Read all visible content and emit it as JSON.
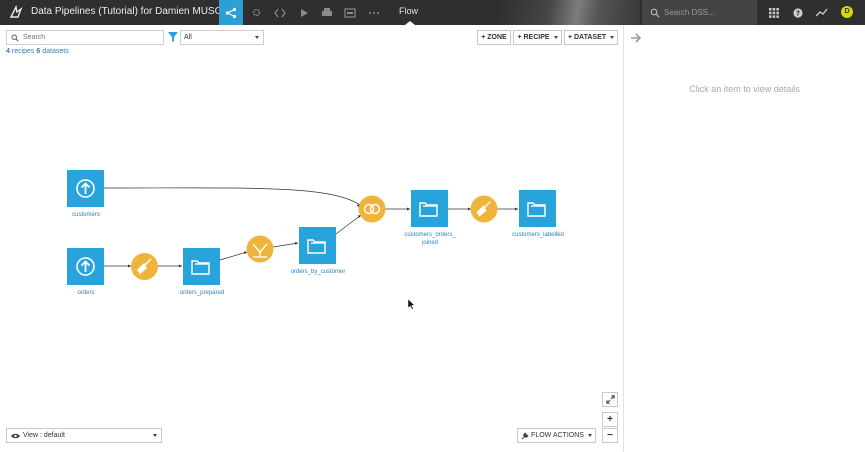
{
  "topbar": {
    "title": "Data Pipelines (Tutorial) for Damien MUSC...",
    "active_section": "Flow",
    "search_placeholder": "Search DSS...",
    "avatar_initial": "D",
    "accent_color": "#2aa0d4"
  },
  "toolbar": {
    "search_placeholder": "Search",
    "filter_value": "All",
    "zone_label": "+ ZONE",
    "recipe_label": "+ RECIPE",
    "dataset_label": "+ DATASET"
  },
  "counts": {
    "recipes_num": "4",
    "recipes_word": "recipes",
    "datasets_num": "6",
    "datasets_word": "datasets"
  },
  "flow": {
    "datasets": {
      "customers": "customers",
      "orders": "orders",
      "orders_prepared": "orders_prepared",
      "orders_by_customer": "orders_by_customer",
      "customers_orders_joined_1": "customers_orders_",
      "customers_orders_joined_2": "joined",
      "customers_labelled": "customers_labelled"
    },
    "recipes": [
      {
        "kind": "prepare",
        "icon": "broom-icon"
      },
      {
        "kind": "group",
        "icon": "group-icon"
      },
      {
        "kind": "join",
        "icon": "join-icon"
      },
      {
        "kind": "prepare",
        "icon": "broom-icon"
      }
    ],
    "dataset_color": "#29a3dc",
    "recipe_color": "#f0b43c"
  },
  "right_panel": {
    "message": "Click an item to view details"
  },
  "bottom": {
    "view_label": "View : default",
    "flow_actions_label": "FLOW ACTIONS",
    "zoom_in": "+",
    "zoom_out": "−"
  }
}
